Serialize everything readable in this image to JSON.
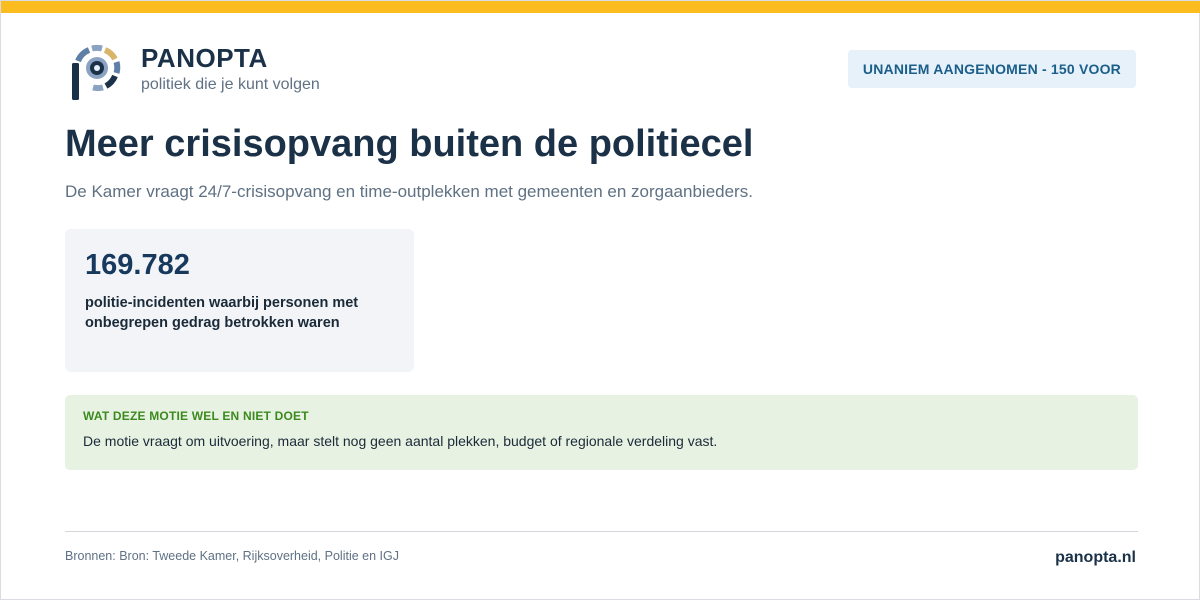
{
  "brand": {
    "name": "PANOPTA",
    "tagline": "politiek die je kunt volgen",
    "accent_color": "#fbbc1f",
    "primary_color": "#1b3147"
  },
  "status_badge": {
    "label": "UNANIEM AANGENOMEN - 150 VOOR"
  },
  "title": "Meer crisisopvang buiten de politiecel",
  "subtitle": "De Kamer vraagt 24/7-crisisopvang en time-outplekken met gemeenten en zorgaanbieders.",
  "stat": {
    "value": "169.782",
    "label": "politie-incidenten waarbij personen met onbegrepen gedrag betrokken waren"
  },
  "info": {
    "heading": "WAT DEZE MOTIE WEL EN NIET DOET",
    "text": "De motie vraagt om uitvoering, maar stelt nog geen aantal plekken, budget of regionale verdeling vast."
  },
  "footer": {
    "sources": "Bronnen: Bron: Tweede Kamer, Rijksoverheid, Politie en IGJ",
    "url": "panopta.nl"
  }
}
